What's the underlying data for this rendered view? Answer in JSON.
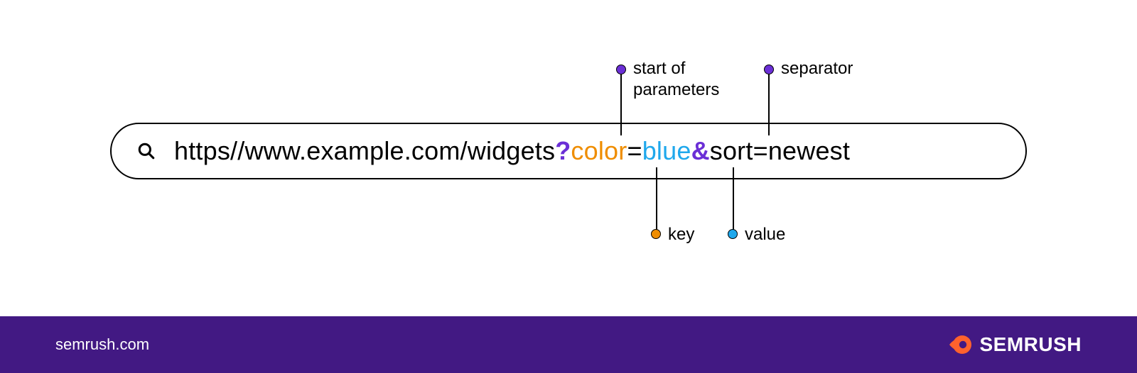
{
  "url": {
    "base": "https//www.example.com/widgets",
    "start_delim": "?",
    "param1_key": "color",
    "equals1": "=",
    "param1_value": "blue",
    "separator": "&",
    "param2_key": "sort",
    "equals2": "=",
    "param2_value": "newest"
  },
  "annotations": {
    "start_of_parameters": "start of\nparameters",
    "separator": "separator",
    "key": "key",
    "value": "value"
  },
  "colors": {
    "purple": "#6b2fd6",
    "orange": "#ef8d00",
    "blue": "#1fa8ec",
    "brand_bg": "#421983",
    "brand_accent": "#ff622d"
  },
  "footer": {
    "site": "semrush.com",
    "brand_name": "SEMRUSH"
  }
}
